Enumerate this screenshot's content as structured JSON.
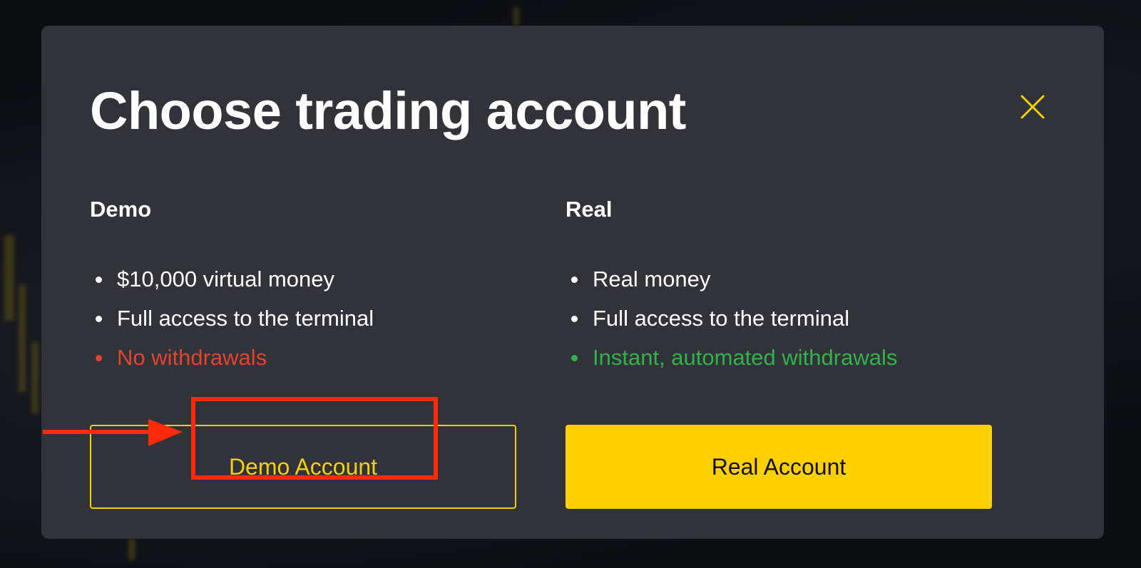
{
  "dialog": {
    "title": "Choose trading account",
    "close_icon": "close-icon",
    "accent_color": "#f5cf0c",
    "background_color": "#323338"
  },
  "demo": {
    "heading": "Demo",
    "features": [
      {
        "text": "$10,000 virtual money",
        "status": "neutral"
      },
      {
        "text": "Full access to the terminal",
        "status": "neutral"
      },
      {
        "text": "No withdrawals",
        "status": "negative"
      }
    ],
    "button_label": "Demo Account",
    "negative_color": "#e0442f"
  },
  "real": {
    "heading": "Real",
    "features": [
      {
        "text": "Real money",
        "status": "neutral"
      },
      {
        "text": "Full access to the terminal",
        "status": "neutral"
      },
      {
        "text": "Instant, automated withdrawals",
        "status": "positive"
      }
    ],
    "button_label": "Real Account",
    "positive_color": "#2fb34a",
    "button_color": "#ffd000"
  },
  "annotation": {
    "highlight_target": "Demo Account",
    "highlight_color": "#ff2a0a",
    "arrow_icon": "arrow-right-icon"
  }
}
